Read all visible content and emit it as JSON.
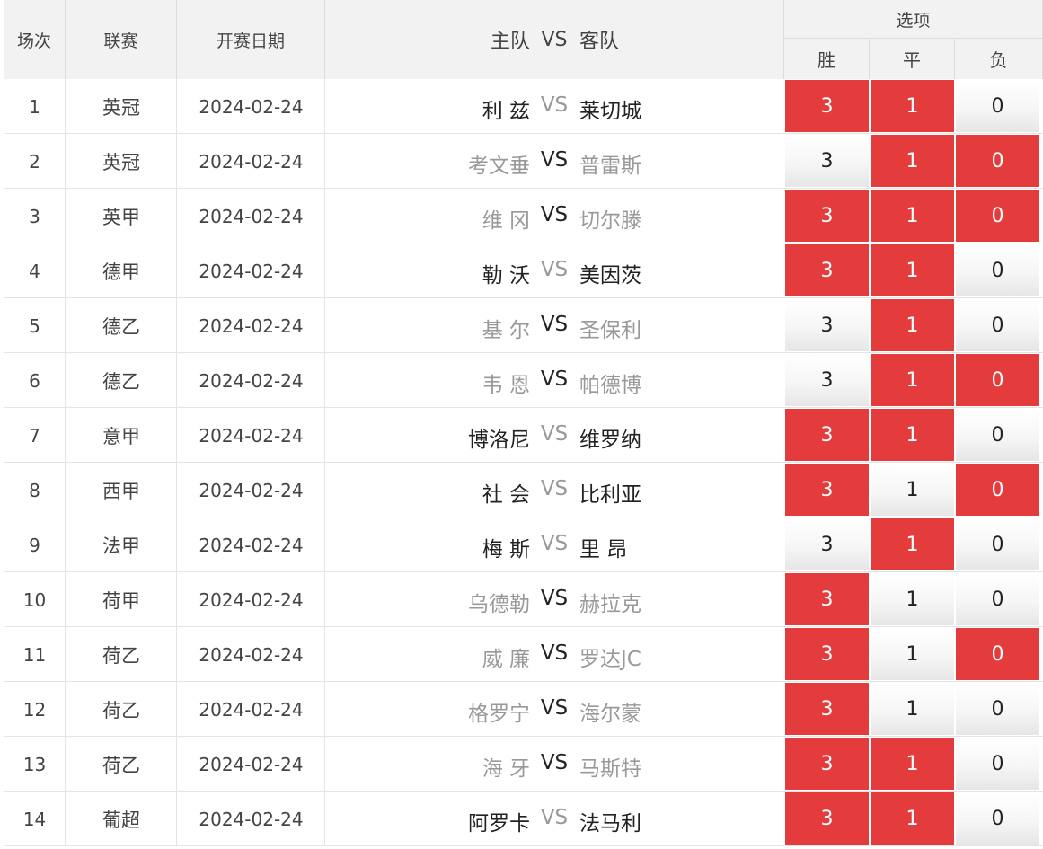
{
  "header": {
    "round": "场次",
    "league": "联赛",
    "date": "开赛日期",
    "home": "主队",
    "vs": "VS",
    "away": "客队",
    "options": "选项",
    "win": "胜",
    "draw": "平",
    "loss": "负"
  },
  "colors": {
    "selected": "#e43c3d",
    "header_bg": "#f2f2f2",
    "team_dark": "#222222",
    "team_gray": "#999999"
  },
  "rows": [
    {
      "no": "1",
      "league": "英冠",
      "date": "2024-02-24",
      "home": "利 兹",
      "away": "莱切城",
      "vs": "VS",
      "win": "3",
      "draw": "1",
      "loss": "0",
      "home_style": "dark",
      "away_style": "dark",
      "vs_style": "gray",
      "sel": [
        true,
        true,
        false
      ]
    },
    {
      "no": "2",
      "league": "英冠",
      "date": "2024-02-24",
      "home": "考文垂",
      "away": "普雷斯",
      "vs": "VS",
      "win": "3",
      "draw": "1",
      "loss": "0",
      "home_style": "gray",
      "away_style": "gray",
      "vs_style": "dark",
      "sel": [
        false,
        true,
        true
      ]
    },
    {
      "no": "3",
      "league": "英甲",
      "date": "2024-02-24",
      "home": "维 冈",
      "away": "切尔滕",
      "vs": "VS",
      "win": "3",
      "draw": "1",
      "loss": "0",
      "home_style": "gray",
      "away_style": "gray",
      "vs_style": "dark",
      "sel": [
        true,
        true,
        true
      ]
    },
    {
      "no": "4",
      "league": "德甲",
      "date": "2024-02-24",
      "home": "勒 沃",
      "away": "美因茨",
      "vs": "VS",
      "win": "3",
      "draw": "1",
      "loss": "0",
      "home_style": "dark",
      "away_style": "dark",
      "vs_style": "gray",
      "sel": [
        true,
        true,
        false
      ]
    },
    {
      "no": "5",
      "league": "德乙",
      "date": "2024-02-24",
      "home": "基 尔",
      "away": "圣保利",
      "vs": "VS",
      "win": "3",
      "draw": "1",
      "loss": "0",
      "home_style": "gray",
      "away_style": "gray",
      "vs_style": "dark",
      "sel": [
        false,
        true,
        false
      ]
    },
    {
      "no": "6",
      "league": "德乙",
      "date": "2024-02-24",
      "home": "韦 恩",
      "away": "帕德博",
      "vs": "VS",
      "win": "3",
      "draw": "1",
      "loss": "0",
      "home_style": "gray",
      "away_style": "gray",
      "vs_style": "dark",
      "sel": [
        false,
        true,
        true
      ]
    },
    {
      "no": "7",
      "league": "意甲",
      "date": "2024-02-24",
      "home": "博洛尼",
      "away": "维罗纳",
      "vs": "VS",
      "win": "3",
      "draw": "1",
      "loss": "0",
      "home_style": "dark",
      "away_style": "dark",
      "vs_style": "gray",
      "sel": [
        true,
        true,
        false
      ]
    },
    {
      "no": "8",
      "league": "西甲",
      "date": "2024-02-24",
      "home": "社 会",
      "away": "比利亚",
      "vs": "VS",
      "win": "3",
      "draw": "1",
      "loss": "0",
      "home_style": "dark",
      "away_style": "dark",
      "vs_style": "gray",
      "sel": [
        true,
        false,
        true
      ]
    },
    {
      "no": "9",
      "league": "法甲",
      "date": "2024-02-24",
      "home": "梅 斯",
      "away": "里 昂",
      "vs": "VS",
      "win": "3",
      "draw": "1",
      "loss": "0",
      "home_style": "dark",
      "away_style": "dark",
      "vs_style": "gray",
      "sel": [
        false,
        true,
        false
      ]
    },
    {
      "no": "10",
      "league": "荷甲",
      "date": "2024-02-24",
      "home": "乌德勒",
      "away": "赫拉克",
      "vs": "VS",
      "win": "3",
      "draw": "1",
      "loss": "0",
      "home_style": "gray",
      "away_style": "gray",
      "vs_style": "dark",
      "sel": [
        true,
        false,
        false
      ]
    },
    {
      "no": "11",
      "league": "荷乙",
      "date": "2024-02-24",
      "home": "威 廉",
      "away": "罗达JC",
      "vs": "VS",
      "win": "3",
      "draw": "1",
      "loss": "0",
      "home_style": "gray",
      "away_style": "gray",
      "vs_style": "dark",
      "sel": [
        true,
        false,
        true
      ]
    },
    {
      "no": "12",
      "league": "荷乙",
      "date": "2024-02-24",
      "home": "格罗宁",
      "away": "海尔蒙",
      "vs": "VS",
      "win": "3",
      "draw": "1",
      "loss": "0",
      "home_style": "gray",
      "away_style": "gray",
      "vs_style": "dark",
      "sel": [
        true,
        false,
        false
      ]
    },
    {
      "no": "13",
      "league": "荷乙",
      "date": "2024-02-24",
      "home": "海 牙",
      "away": "马斯特",
      "vs": "VS",
      "win": "3",
      "draw": "1",
      "loss": "0",
      "home_style": "gray",
      "away_style": "gray",
      "vs_style": "dark",
      "sel": [
        true,
        true,
        false
      ]
    },
    {
      "no": "14",
      "league": "葡超",
      "date": "2024-02-24",
      "home": "阿罗卡",
      "away": "法马利",
      "vs": "VS",
      "win": "3",
      "draw": "1",
      "loss": "0",
      "home_style": "dark",
      "away_style": "dark",
      "vs_style": "gray",
      "sel": [
        true,
        true,
        false
      ]
    }
  ]
}
